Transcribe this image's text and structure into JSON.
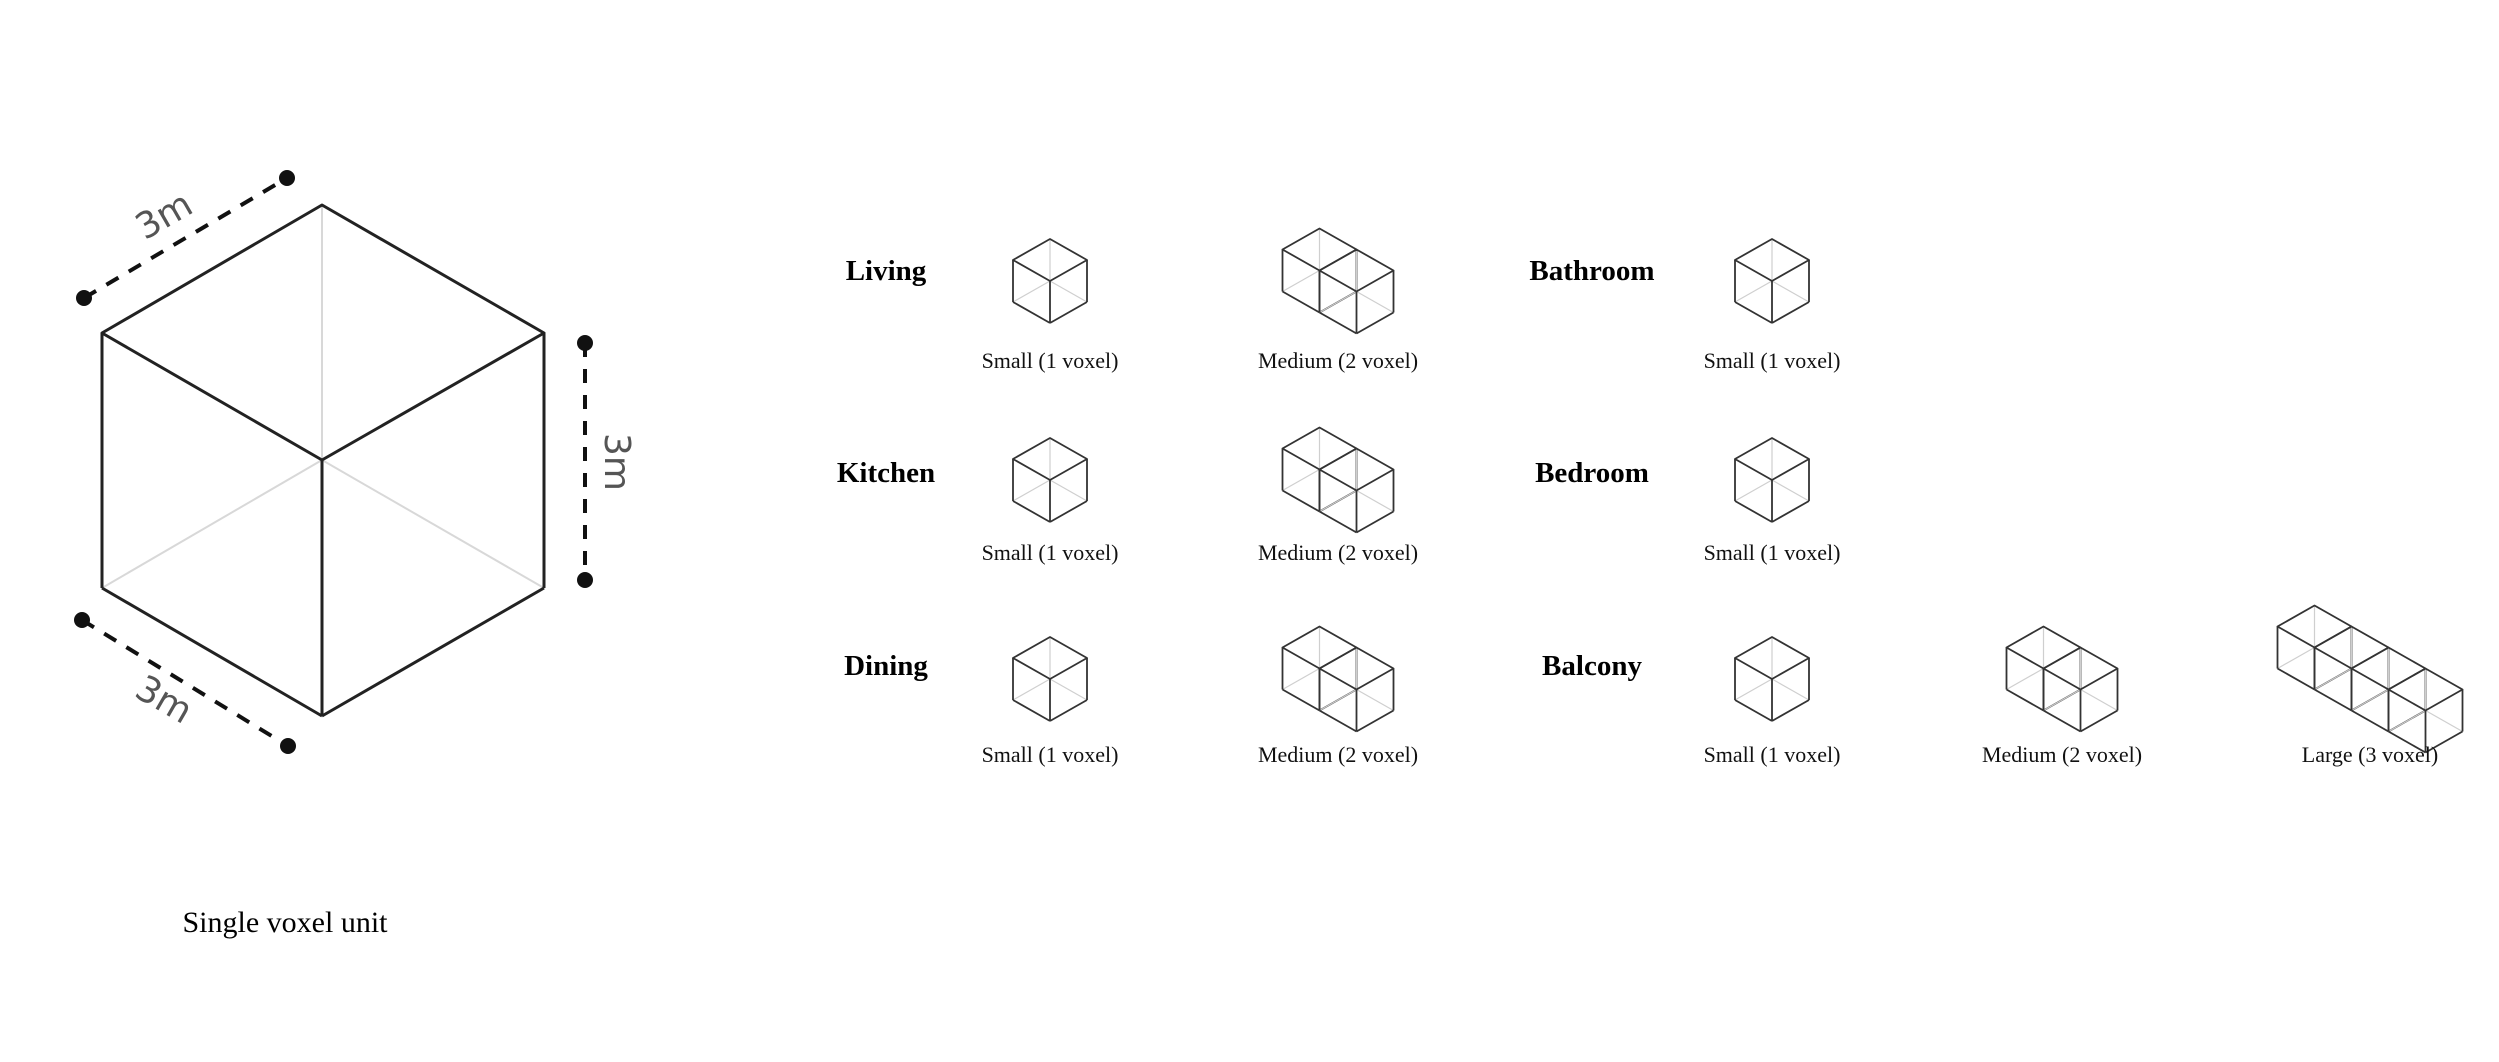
{
  "unit": {
    "caption": "Single voxel unit",
    "dimension_top": "3m",
    "dimension_right": "3m",
    "dimension_bottom": "3m"
  },
  "rooms": [
    {
      "name": "Living",
      "sizes": [
        {
          "label": "Small (1 voxel)",
          "voxels": 1
        },
        {
          "label": "Medium (2 voxel)",
          "voxels": 2
        }
      ]
    },
    {
      "name": "Kitchen",
      "sizes": [
        {
          "label": "Small (1 voxel)",
          "voxels": 1
        },
        {
          "label": "Medium (2 voxel)",
          "voxels": 2
        }
      ]
    },
    {
      "name": "Dining",
      "sizes": [
        {
          "label": "Small (1 voxel)",
          "voxels": 1
        },
        {
          "label": "Medium (2 voxel)",
          "voxels": 2
        }
      ]
    },
    {
      "name": "Bathroom",
      "sizes": [
        {
          "label": "Small (1 voxel)",
          "voxels": 1
        }
      ]
    },
    {
      "name": "Bedroom",
      "sizes": [
        {
          "label": "Small (1 voxel)",
          "voxels": 1
        }
      ]
    },
    {
      "name": "Balcony",
      "sizes": [
        {
          "label": "Small (1 voxel)",
          "voxels": 1
        },
        {
          "label": "Medium (2 voxel)",
          "voxels": 2
        },
        {
          "label": "Large (3 voxel)",
          "voxels": 4
        }
      ]
    }
  ]
}
